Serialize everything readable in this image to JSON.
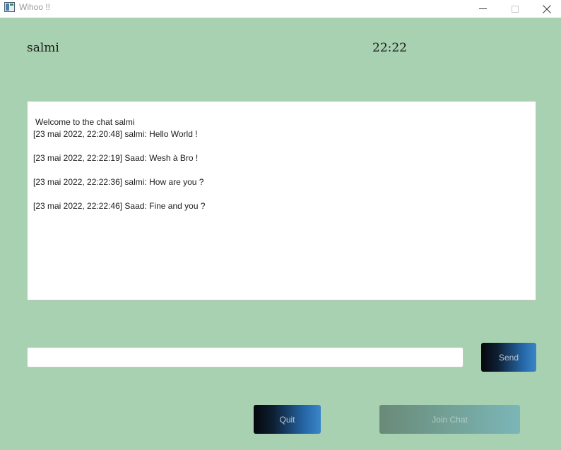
{
  "window": {
    "title": "Wihoo !!"
  },
  "header": {
    "username": "salmi",
    "time": "22:22"
  },
  "chat": {
    "welcome": "Welcome to the chat salmi",
    "messages": [
      "[23 mai 2022, 22:20:48] salmi: Hello World !",
      "[23 mai 2022, 22:22:19] Saad: Wesh à Bro !",
      "[23 mai 2022, 22:22:36] salmi: How are you ?",
      "[23 mai 2022, 22:22:46] Saad: Fine and you ?"
    ]
  },
  "composer": {
    "input_value": "",
    "send_label": "Send"
  },
  "actions": {
    "quit_label": "Quit",
    "join_label": "Join Chat",
    "join_disabled": true
  },
  "icons": {
    "app": "app-window-icon",
    "minimize": "minimize-icon",
    "maximize": "maximize-icon",
    "close": "close-icon"
  }
}
